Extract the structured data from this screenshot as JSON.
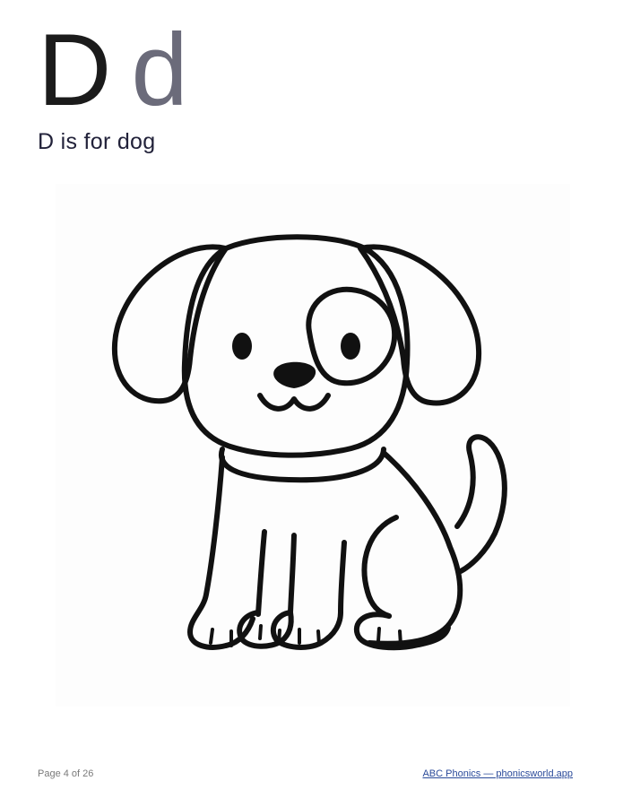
{
  "header": {
    "letter_upper": "D",
    "letter_lower": "d",
    "phrase": "D is for dog"
  },
  "illustration": {
    "subject": "dog",
    "style": "black outline coloring page"
  },
  "footer": {
    "page_indicator": "Page 4 of 26",
    "link_text": "ABC Phonics — phonicsworld.app"
  },
  "colors": {
    "letter_upper": "#1b1b1b",
    "letter_lower": "#6b6b7a",
    "subtitle": "#22223a",
    "link": "#2a4a9a",
    "footer_text": "#7a7a7a",
    "outline": "#111111"
  }
}
